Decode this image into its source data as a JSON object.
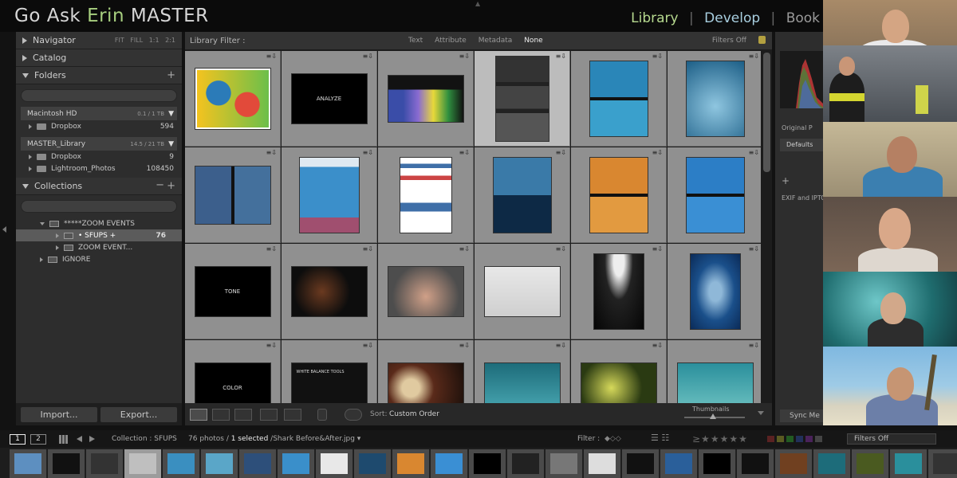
{
  "header": {
    "title_main": "Go Ask",
    "title_accent": "Erin",
    "title_suffix": "MASTER",
    "modules": [
      "Library",
      "Develop",
      "Book"
    ]
  },
  "left_panel": {
    "navigator": {
      "label": "Navigator",
      "opts": [
        "FIT",
        "FILL",
        "1:1",
        "2:1"
      ]
    },
    "catalog": {
      "label": "Catalog"
    },
    "folders": {
      "label": "Folders",
      "volumes": [
        {
          "name": "Macintosh HD",
          "capacity": "0.1 / 1 TB",
          "children": [
            {
              "name": "Dropbox",
              "count": "594"
            }
          ]
        },
        {
          "name": "MASTER_Library",
          "capacity": "14.5 / 21 TB",
          "children": [
            {
              "name": "Dropbox",
              "count": "9"
            },
            {
              "name": "Lightroom_Photos",
              "count": "108450"
            }
          ]
        }
      ]
    },
    "collections": {
      "label": "Collections",
      "items": [
        {
          "name": "*****ZOOM EVENTS",
          "count": ""
        },
        {
          "name": "• SFUPS  +",
          "count": "76"
        },
        {
          "name": "ZOOM EVENT...",
          "count": ""
        },
        {
          "name": "IGNORE",
          "count": ""
        }
      ]
    },
    "import_label": "Import...",
    "export_label": "Export..."
  },
  "filter_bar": {
    "label": "Library Filter :",
    "options": [
      "Text",
      "Attribute",
      "Metadata",
      "None"
    ],
    "active": "None",
    "status": "Filters Off"
  },
  "grid": {
    "cells": [
      {
        "kind": "diagram",
        "label": ""
      },
      {
        "kind": "text",
        "label": "ANALYZE"
      },
      {
        "kind": "histogram",
        "label": ""
      },
      {
        "kind": "exposure",
        "label": "",
        "selected": true
      },
      {
        "kind": "shark",
        "label": ""
      },
      {
        "kind": "fishschool",
        "label": ""
      },
      {
        "kind": "reef",
        "label": ""
      },
      {
        "kind": "diver",
        "label": ""
      },
      {
        "kind": "flowchart",
        "label": ""
      },
      {
        "kind": "reef2",
        "label": ""
      },
      {
        "kind": "fish-orange",
        "label": ""
      },
      {
        "kind": "stingray",
        "label": ""
      },
      {
        "kind": "text",
        "label": "TONE"
      },
      {
        "kind": "dark",
        "label": ""
      },
      {
        "kind": "cloudy",
        "label": ""
      },
      {
        "kind": "white",
        "label": ""
      },
      {
        "kind": "cave",
        "label": ""
      },
      {
        "kind": "blue-school",
        "label": ""
      },
      {
        "kind": "text",
        "label": "COLOR"
      },
      {
        "kind": "wb",
        "label": "WHITE BALANCE TOOLS"
      },
      {
        "kind": "anemone",
        "label": ""
      },
      {
        "kind": "teal",
        "label": ""
      },
      {
        "kind": "green",
        "label": ""
      },
      {
        "kind": "fishes",
        "label": ""
      }
    ]
  },
  "toolbar": {
    "sort_label": "Sort:",
    "sort_value": "Custom Order",
    "thumbnails_label": "Thumbnails"
  },
  "right_panel": {
    "original_label": "Original P",
    "defaults_label": "Defaults",
    "plus": "+",
    "exif_label": "EXIF and IPTC",
    "sync_label": "Sync Me"
  },
  "filmstrip_bar": {
    "screen1": "1",
    "screen2": "2",
    "collection": "Collection : SFUPS",
    "count_text": "76 photos / ",
    "selected_text": "1 selected",
    "file_text": " /Shark Before&After.jpg",
    "filter_label": "Filter :",
    "filters_off": "Filters Off"
  },
  "colors": {
    "accent_green": "#a7cf7f",
    "develop_blue": "#a8cfe0",
    "panel": "#2d2d2d",
    "grid_cell": "#909090"
  }
}
